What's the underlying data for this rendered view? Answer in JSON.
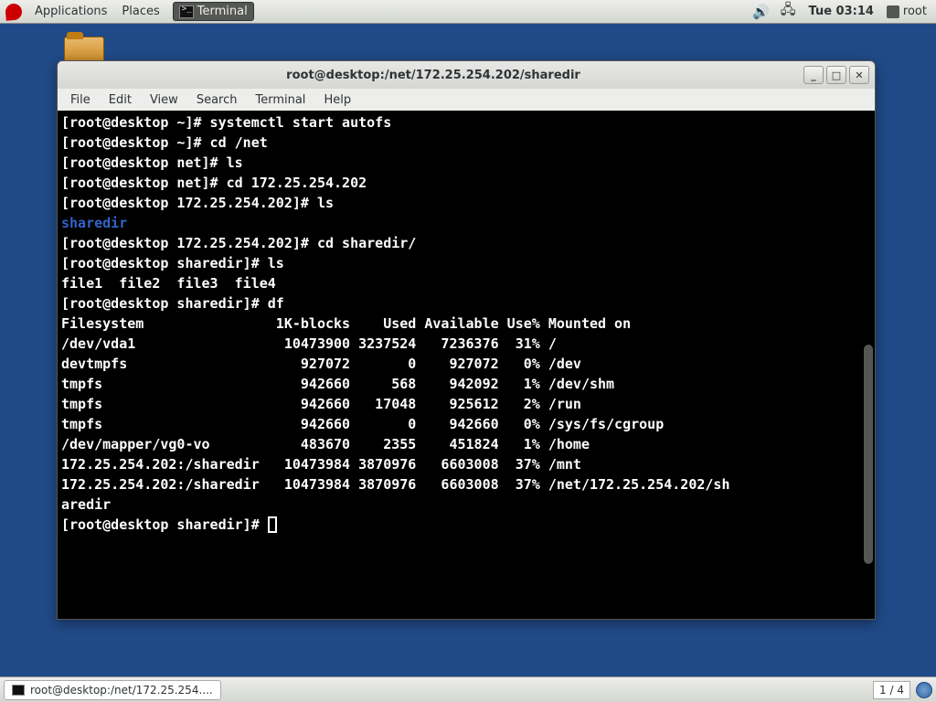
{
  "top_panel": {
    "applications": "Applications",
    "places": "Places",
    "task_terminal": "Terminal",
    "clock": "Tue 03:14",
    "user": "root"
  },
  "window": {
    "title": "root@desktop:/net/172.25.254.202/sharedir",
    "menubar": {
      "file": "File",
      "edit": "Edit",
      "view": "View",
      "search": "Search",
      "terminal": "Terminal",
      "help": "Help"
    }
  },
  "terminal_lines": {
    "l0": "[root@desktop ~]# systemctl start autofs",
    "l1": "[root@desktop ~]# cd /net",
    "l2": "[root@desktop net]# ls",
    "l3": "[root@desktop net]# cd 172.25.254.202",
    "l4": "[root@desktop 172.25.254.202]# ls",
    "l5": "sharedir",
    "l6": "[root@desktop 172.25.254.202]# cd sharedir/",
    "l7": "[root@desktop sharedir]# ls",
    "l8": "file1  file2  file3  file4",
    "l9": "[root@desktop sharedir]# df",
    "l10": "Filesystem                1K-blocks    Used Available Use% Mounted on",
    "l11": "/dev/vda1                  10473900 3237524   7236376  31% /",
    "l12": "devtmpfs                     927072       0    927072   0% /dev",
    "l13": "tmpfs                        942660     568    942092   1% /dev/shm",
    "l14": "tmpfs                        942660   17048    925612   2% /run",
    "l15": "tmpfs                        942660       0    942660   0% /sys/fs/cgroup",
    "l16": "/dev/mapper/vg0-vo           483670    2355    451824   1% /home",
    "l17": "172.25.254.202:/sharedir   10473984 3870976   6603008  37% /mnt",
    "l18": "172.25.254.202:/sharedir   10473984 3870976   6603008  37% /net/172.25.254.202/sh",
    "l19": "aredir",
    "l20": "[root@desktop sharedir]# "
  },
  "bottom_panel": {
    "task_label": "root@desktop:/net/172.25.254....",
    "workspace": "1 / 4"
  }
}
